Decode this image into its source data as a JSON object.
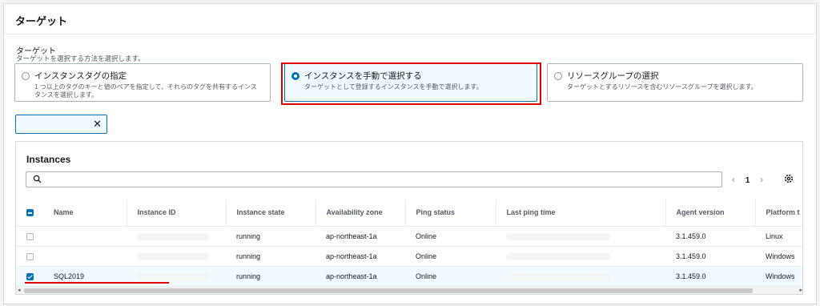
{
  "section": {
    "title": "ターゲット"
  },
  "target": {
    "label": "ターゲット",
    "description": "ターゲットを選択する方法を選択します。",
    "options": [
      {
        "title": "インスタンスタグの指定",
        "desc": "1 つ以上のタグのキーと値のペアを指定して、それらのタグを共有するインスタンスを選択します。",
        "selected": false
      },
      {
        "title": "インスタンスを手動で選択する",
        "desc": "ターゲットとして登録するインスタンスを手動で選択します。",
        "selected": true
      },
      {
        "title": "リソースグループの選択",
        "desc": "ターゲットとするリソースを含むリソースグループを選択します。",
        "selected": false
      }
    ]
  },
  "token": {
    "close_glyph": "✕"
  },
  "instances": {
    "title": "Instances",
    "pager": {
      "prev": "‹",
      "page": "1",
      "next": "›"
    },
    "columns": [
      "Name",
      "Instance ID",
      "Instance state",
      "Availability zone",
      "Ping status",
      "Last ping time",
      "Agent version",
      "Platform t"
    ],
    "rows": [
      {
        "name": "",
        "id": "",
        "state": "running",
        "az": "ap-northeast-1a",
        "ping": "Online",
        "last": "",
        "agent": "3.1.459.0",
        "platform": "Linux",
        "checked": false
      },
      {
        "name": "",
        "id": "",
        "state": "running",
        "az": "ap-northeast-1a",
        "ping": "Online",
        "last": "",
        "agent": "3.1.459.0",
        "platform": "Windows",
        "checked": false
      },
      {
        "name": "SQL2019",
        "id": "",
        "state": "running",
        "az": "ap-northeast-1a",
        "ping": "Online",
        "last": "",
        "agent": "3.1.459.0",
        "platform": "Windows",
        "checked": true
      }
    ]
  },
  "colors": {
    "accent": "#0073bb",
    "highlight": "#e00000"
  },
  "icons": {
    "search": "search-icon",
    "settings": "gear-icon"
  }
}
